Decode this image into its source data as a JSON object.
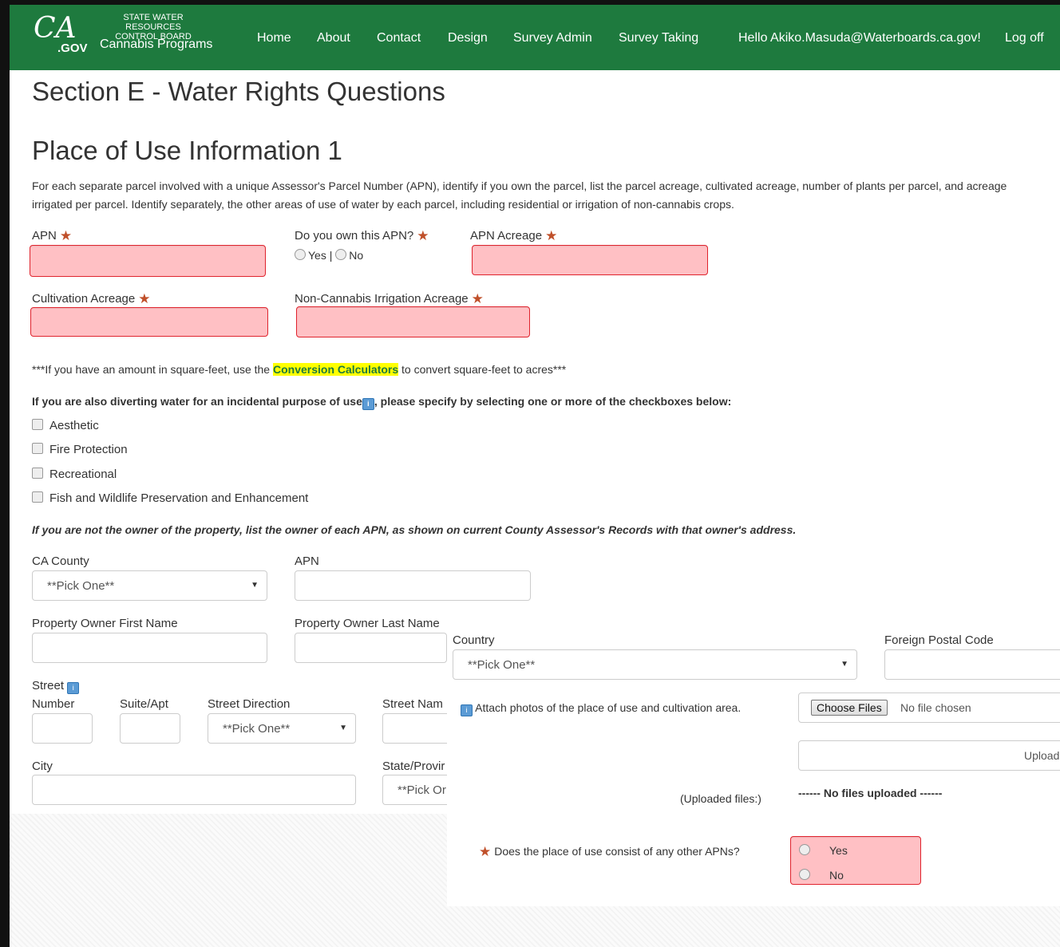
{
  "header": {
    "logo_ca": "CA",
    "logo_gov": ".GOV",
    "org_line1": "STATE WATER RESOURCES",
    "org_line2": "CONTROL BOARD",
    "program": "Cannabis Programs",
    "nav": [
      "Home",
      "About",
      "Contact",
      "Design",
      "Survey Admin",
      "Survey Taking"
    ],
    "greeting": "Hello Akiko.Masuda@Waterboards.ca.gov!",
    "logoff": "Log off"
  },
  "page": {
    "section_title": "Section E - Water Rights Questions",
    "subtitle": "Place of Use Information 1",
    "intro": "For each separate parcel involved with a unique Assessor's Parcel Number (APN), identify if you own the parcel, list the parcel acreage, cultivated acreage, number of plants per parcel, and acreage irrigated per parcel. Identify separately, the other areas of use of water by each parcel, including residential or irrigation of non-cannabis crops."
  },
  "fields": {
    "apn_label": "APN",
    "own_label": "Do you own this APN?",
    "own_yes": "Yes",
    "own_sep": "|",
    "own_no": "No",
    "apn_acreage_label": "APN Acreage",
    "cultivation_label": "Cultivation Acreage",
    "noncannabis_label": "Non-Cannabis Irrigation Acreage"
  },
  "conversion": {
    "prefix": "***If you have an amount in square-feet, use the ",
    "link": "Conversion Calculators",
    "suffix": " to convert square-feet to acres***"
  },
  "incidental": {
    "prefix": "If you are also diverting water for an incidental purpose of use",
    "suffix": ", please specify by selecting one or more of the checkboxes below:",
    "options": [
      "Aesthetic",
      "Fire Protection",
      "Recreational",
      "Fish and Wildlife Preservation and Enhancement"
    ]
  },
  "owner": {
    "instruction": "If you are not the owner of the property, list the owner of each APN, as shown on current County Assessor's Records with that owner's address.",
    "county_label": "CA County",
    "county_value": "**Pick One**",
    "apn_label": "APN",
    "first_name_label": "Property Owner First Name",
    "last_name_label": "Property Owner Last Name",
    "street_label": "Street",
    "number_label": "Number",
    "suite_label": "Suite/Apt",
    "direction_label": "Street Direction",
    "direction_value": "**Pick One**",
    "street_name_label": "Street Nam",
    "city_label": "City",
    "state_label": "State/Provir",
    "state_value": "**Pick Or"
  },
  "overlay": {
    "country_label": "Country",
    "country_value": "**Pick One**",
    "postal_label": "Foreign Postal Code",
    "attach_label": "Attach photos of the place of use and cultivation area.",
    "choose_files": "Choose Files",
    "no_file": "No file chosen",
    "upload": "Upload",
    "uploaded_label": "(Uploaded files:)",
    "no_files_uploaded": "------ No files uploaded ------",
    "other_apns_q": "Does the place of use consist of any other APNs?",
    "other_yes": "Yes",
    "other_no": "No"
  },
  "colors": {
    "nav_green": "#1e7a3e",
    "error_fill": "#ffc0c4",
    "error_border": "#e0242e",
    "required_star": "#c0502a",
    "highlight": "#ffff00"
  }
}
